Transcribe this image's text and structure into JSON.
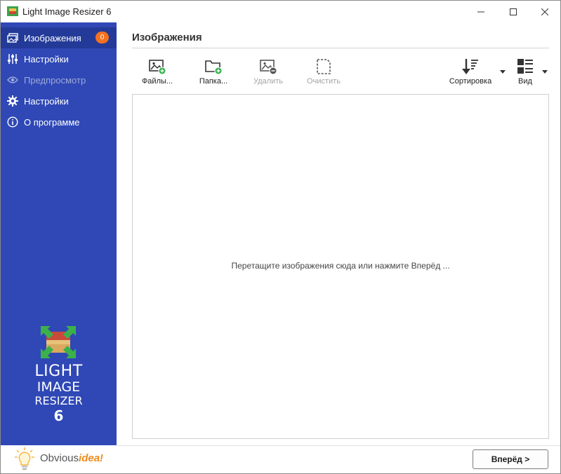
{
  "window": {
    "title": "Light Image Resizer 6"
  },
  "sidebar": {
    "items": [
      {
        "label": "Изображения",
        "icon": "images-icon",
        "badge": "0",
        "active": true
      },
      {
        "label": "Настройки",
        "icon": "sliders-icon"
      },
      {
        "label": "Предпросмотр",
        "icon": "eye-icon",
        "disabled": true
      },
      {
        "label": "Настройки",
        "icon": "gear-icon"
      },
      {
        "label": "О программе",
        "icon": "info-icon"
      }
    ],
    "logo": {
      "line1": "LIGHT",
      "line2": "IMAGE",
      "line3": "RESIZER",
      "line4": "6"
    },
    "brand": {
      "part1": "Obvious",
      "part2": "idea!"
    }
  },
  "main": {
    "title": "Изображения",
    "toolbar": {
      "files": "Файлы...",
      "folder": "Папка...",
      "remove": "Удалить",
      "clear": "Очистить",
      "sort": "Сортировка",
      "view": "Вид"
    },
    "drop_hint": "Перетащите изображения сюда или нажмите Вперёд ...",
    "next_button": "Вперёд >"
  },
  "colors": {
    "sidebar_bg": "#2f48b6",
    "sidebar_active": "#243a99",
    "badge": "#f4711f",
    "add_green": "#2fb34a"
  }
}
